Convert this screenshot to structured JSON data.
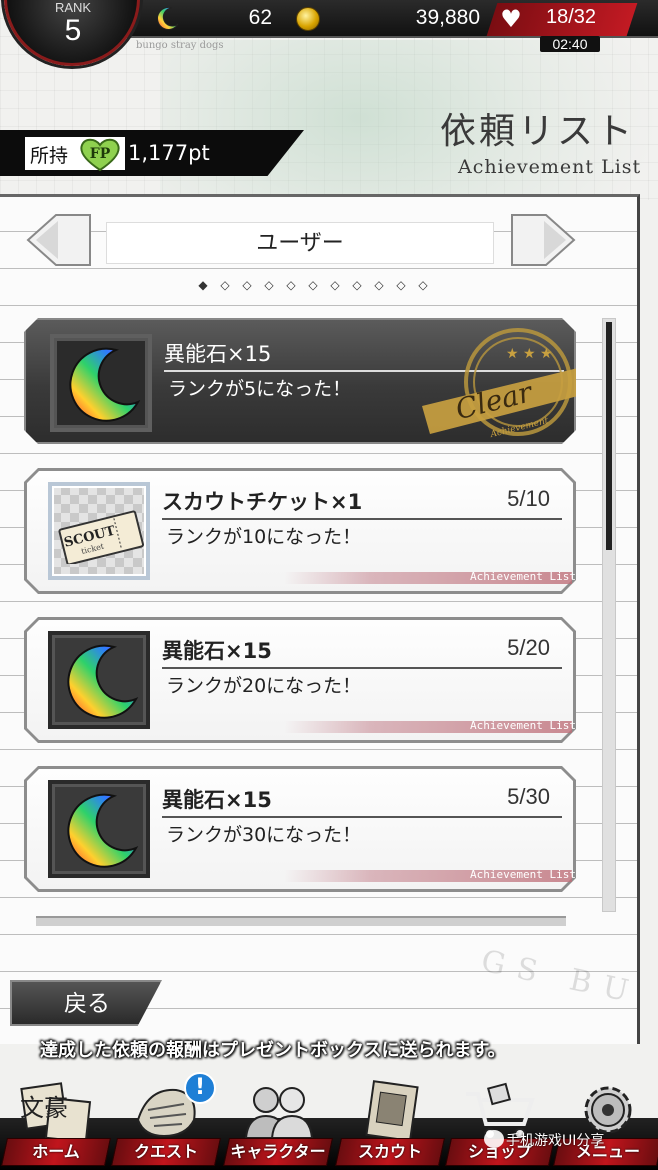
{
  "status_bar": {
    "rank_label": "RANK",
    "rank_value": "5",
    "game_subtitle": "bungo stray dogs",
    "stones": "62",
    "coins": "39,880",
    "ap_icon": "AP",
    "ap_value": "18/32",
    "ap_timer": "02:40"
  },
  "header": {
    "title": "依頼リスト",
    "subtitle": "Achievement List"
  },
  "points": {
    "label": "所持",
    "badge": "FP",
    "value": "1,177pt"
  },
  "category": {
    "label": "ユーザー",
    "page_dots": [
      "◆",
      "◇",
      "◇",
      "◇",
      "◇",
      "◇",
      "◇",
      "◇",
      "◇",
      "◇",
      "◇"
    ]
  },
  "achievements": [
    {
      "reward": "異能石×15",
      "condition": "ランクが5になった！",
      "progress": "",
      "icon": "moon-stone-icon",
      "cleared": true,
      "stamp_text": "Clear",
      "stamp_sub": "Achievement"
    },
    {
      "reward": "スカウトチケット×1",
      "condition": "ランクが10になった！",
      "progress": "5/10",
      "icon": "scout-ticket-icon",
      "cleared": false,
      "footer": "Achievement List"
    },
    {
      "reward": "異能石×15",
      "condition": "ランクが20になった！",
      "progress": "5/20",
      "icon": "moon-stone-icon",
      "cleared": false,
      "footer": "Achievement List"
    },
    {
      "reward": "異能石×15",
      "condition": "ランクが30になった！",
      "progress": "5/30",
      "icon": "moon-stone-icon",
      "cleared": false,
      "footer": "Achievement List"
    }
  ],
  "ticket_art": {
    "line1": "SCOUT",
    "line2": "ticket"
  },
  "back_button": "戻る",
  "notice": "達成した依頼の報酬はプレゼントボックスに送られます。",
  "decor_letters": "GS BU",
  "bottom_nav": [
    {
      "label": "ホーム",
      "icon": "home-book-icon",
      "art": "文豪"
    },
    {
      "label": "クエスト",
      "icon": "quest-icon",
      "alert": "!"
    },
    {
      "label": "キャラクター",
      "icon": "characters-icon"
    },
    {
      "label": "スカウト",
      "icon": "scout-icon"
    },
    {
      "label": "ショップ",
      "icon": "shop-cart-icon"
    },
    {
      "label": "メニュー",
      "icon": "menu-gear-icon"
    }
  ],
  "watermark": "手机游戏UI分享",
  "colors": {
    "accent_red": "#c21a23",
    "panel_bg": "#fbfbfb",
    "dark_card": "#3a3a3a",
    "stamp_gold": "#c8a040"
  }
}
